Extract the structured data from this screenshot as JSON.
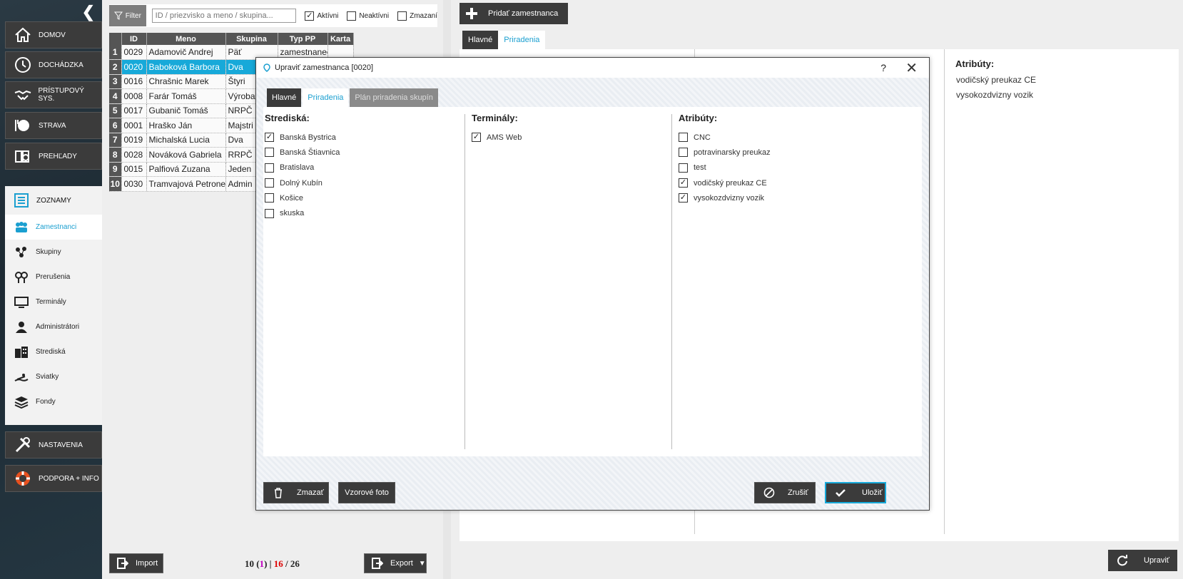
{
  "sidebar": {
    "main_top": [
      {
        "label": "DOMOV",
        "icon": "home-icon"
      },
      {
        "label": "DOCHÁDZKA",
        "icon": "clock-icon"
      },
      {
        "label": "PRÍSTUPOVÝ SYS.",
        "icon": "handshake-icon"
      },
      {
        "label": "STRAVA",
        "icon": "plate-icon"
      },
      {
        "label": "PREHĽADY",
        "icon": "report-icon"
      }
    ],
    "section": {
      "label": "ZOZNAMY",
      "icon": "list-icon"
    },
    "sub": [
      {
        "label": "Zamestnanci",
        "icon": "people-icon"
      },
      {
        "label": "Skupiny",
        "icon": "group-icon"
      },
      {
        "label": "Prerušenia",
        "icon": "pin-icon"
      },
      {
        "label": "Terminály",
        "icon": "monitor-icon"
      },
      {
        "label": "Administrátori",
        "icon": "admin-icon"
      },
      {
        "label": "Strediská",
        "icon": "building-icon"
      },
      {
        "label": "Sviatky",
        "icon": "beach-icon"
      },
      {
        "label": "Fondy",
        "icon": "layers-icon"
      }
    ],
    "main_bottom": [
      {
        "label": "NASTAVENIA",
        "icon": "tools-icon"
      },
      {
        "label": "PODPORA + INFO",
        "icon": "lifebuoy-icon"
      }
    ]
  },
  "list": {
    "filter_label": "Filter",
    "search_placeholder": "ID / priezvisko a meno / skupina...",
    "chk_active": "Aktívni",
    "chk_inactive": "Neaktívni",
    "chk_deleted": "Zmazaní",
    "columns": [
      "ID",
      "Meno",
      "Skupina",
      "Typ PP",
      "Karta"
    ],
    "rows": [
      [
        "1",
        "0029",
        "Adamovič Andrej",
        "Päť",
        "zamestnanec",
        ""
      ],
      [
        "2",
        "0020",
        "Baboková Barbora",
        "Dva",
        "",
        ""
      ],
      [
        "3",
        "0016",
        "Chrašnic Marek",
        "Štyri",
        "",
        ""
      ],
      [
        "4",
        "0008",
        "Farár Tomáš",
        "Výroba",
        "",
        ""
      ],
      [
        "5",
        "0017",
        "Gubanič Tomáš",
        "NRPČ",
        "",
        ""
      ],
      [
        "6",
        "0001",
        "Hraško Ján",
        "Majstri",
        "",
        ""
      ],
      [
        "7",
        "0019",
        "Michalská Lucia",
        "Dva",
        "",
        ""
      ],
      [
        "8",
        "0028",
        "Nováková Gabriela",
        "RRPČ",
        "",
        ""
      ],
      [
        "9",
        "0015",
        "Palfiová Zuzana",
        "Jeden",
        "",
        ""
      ],
      [
        "10",
        "0030",
        "Tramvajová Petronela",
        "Admin",
        "",
        ""
      ]
    ],
    "import_label": "Import",
    "export_label": "Export",
    "counter": {
      "a": "10",
      "b": "1",
      "c": "16",
      "d": "26"
    }
  },
  "detail": {
    "add_label": "Pridať zamestnanca",
    "tabs": [
      "Hlavné",
      "Priradenia"
    ],
    "attr_title": "Atribúty:",
    "attr_values": [
      "vodičský preukaz CE",
      "vysokozdvizny vozik"
    ],
    "update_label": "Upraviť"
  },
  "modal": {
    "title": "Upraviť zamestnanca [0020]",
    "help": "?",
    "close": "✕",
    "tabs": [
      "Hlavné",
      "Priradenia",
      "Plán priradenia skupín"
    ],
    "strediska": {
      "title": "Strediská:",
      "items": [
        {
          "label": "Banská Bystrica",
          "checked": true
        },
        {
          "label": "Banská Štiavnica",
          "checked": false
        },
        {
          "label": "Bratislava",
          "checked": false
        },
        {
          "label": "Dolný Kubín",
          "checked": false
        },
        {
          "label": "Košice",
          "checked": false
        },
        {
          "label": "skuska",
          "checked": false
        }
      ]
    },
    "terminaly": {
      "title": "Terminály:",
      "items": [
        {
          "label": "AMS Web",
          "checked": true
        }
      ]
    },
    "atributy": {
      "title": "Atribúty:",
      "items": [
        {
          "label": "CNC",
          "checked": false
        },
        {
          "label": "potravinarsky preukaz",
          "checked": false
        },
        {
          "label": "test",
          "checked": false
        },
        {
          "label": "vodičský preukaz CE",
          "checked": true
        },
        {
          "label": "vysokozdvizny vozik",
          "checked": true
        }
      ]
    },
    "delete_label": "Zmazať",
    "sample_photo_label": "Vzorové foto",
    "cancel_label": "Zrušiť",
    "save_label": "Uložiť"
  },
  "colors": {
    "accent": "#17a9d9",
    "dark": "#3b3b3b"
  }
}
